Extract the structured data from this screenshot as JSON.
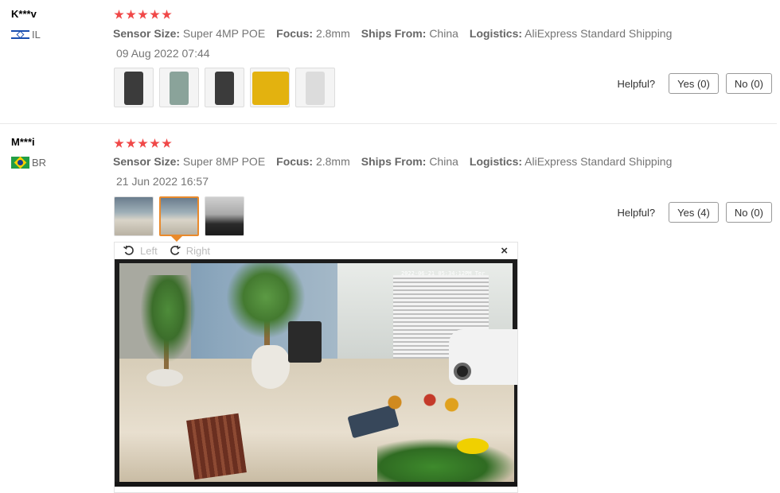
{
  "reviews": [
    {
      "user": "K***v",
      "country": "IL",
      "stars": 5,
      "props": [
        {
          "label": "Sensor Size:",
          "value": "Super 4MP POE"
        },
        {
          "label": "Focus:",
          "value": "2.8mm"
        },
        {
          "label": "Ships From:",
          "value": "China"
        },
        {
          "label": "Logistics:",
          "value": "AliExpress Standard Shipping"
        }
      ],
      "date": "09 Aug 2022 07:44",
      "helpful_label": "Helpful?",
      "yes": "Yes (0)",
      "no": "No (0)"
    },
    {
      "user": "M***i",
      "country": "BR",
      "stars": 5,
      "props": [
        {
          "label": "Sensor Size:",
          "value": "Super 8MP POE"
        },
        {
          "label": "Focus:",
          "value": "2.8mm"
        },
        {
          "label": "Ships From:",
          "value": "China"
        },
        {
          "label": "Logistics:",
          "value": "AliExpress Standard Shipping"
        }
      ],
      "date": "21 Jun 2022 16:57",
      "helpful_label": "Helpful?",
      "yes": "Yes (4)",
      "no": "No (0)"
    }
  ],
  "viewer": {
    "rotate_left": "Left",
    "rotate_right": "Right",
    "close": "×",
    "osd_text": "2022-06-21 05:34:12PM Ter"
  },
  "colors": {
    "star": "#f04848",
    "active_thumb": "#e98a2c"
  }
}
